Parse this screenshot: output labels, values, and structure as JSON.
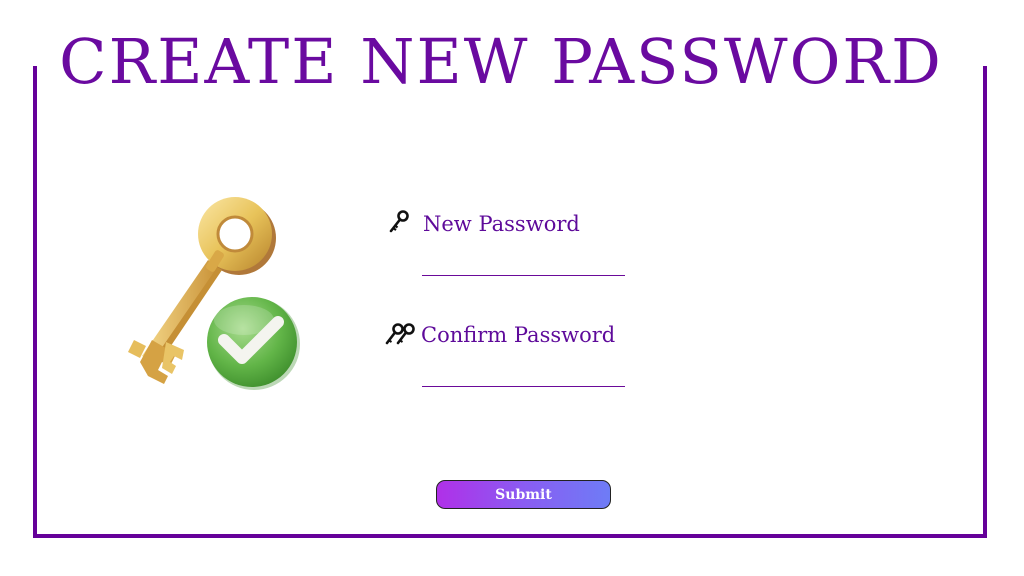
{
  "page": {
    "title": "CREATE NEW PASSWORD"
  },
  "form": {
    "new_password": {
      "label": "New Password",
      "icon": "key-icon",
      "value": "",
      "placeholder": ""
    },
    "confirm_password": {
      "label": "Confirm Password",
      "icon": "keys-icon",
      "value": "",
      "placeholder": ""
    },
    "submit_label": "Submit"
  },
  "hero": {
    "icon": "golden-key-check-icon"
  },
  "colors": {
    "accent": "#650099",
    "label": "#5e0a9a",
    "button_gradient_start": "#b030e8",
    "button_gradient_end": "#6e7cf6",
    "check_green": "#5cb85c",
    "key_gold": "#e8c35a"
  }
}
